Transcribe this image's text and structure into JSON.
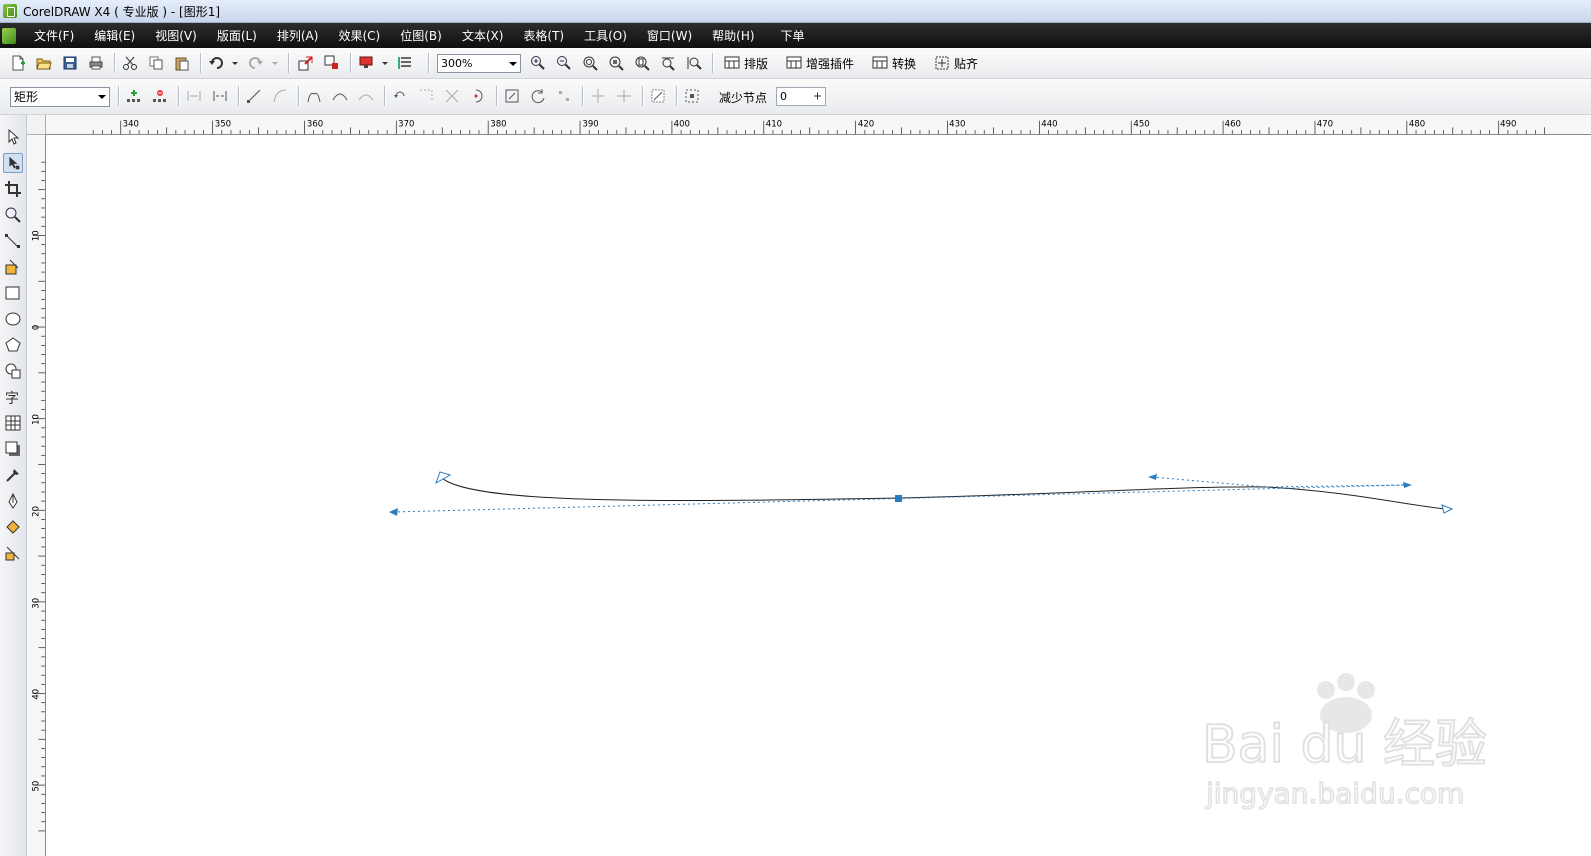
{
  "window": {
    "title": "CorelDRAW X4 ( 专业版 ) - [图形1]"
  },
  "menu": [
    {
      "label": "文件(F)"
    },
    {
      "label": "编辑(E)"
    },
    {
      "label": "视图(V)"
    },
    {
      "label": "版面(L)"
    },
    {
      "label": "排列(A)"
    },
    {
      "label": "效果(C)"
    },
    {
      "label": "位图(B)"
    },
    {
      "label": "文本(X)"
    },
    {
      "label": "表格(T)"
    },
    {
      "label": "工具(O)"
    },
    {
      "label": "窗口(W)"
    },
    {
      "label": "帮助(H)"
    },
    {
      "label": "下单"
    }
  ],
  "toolbar": {
    "zoom_value": "300%",
    "plugins": [
      {
        "label": "排版"
      },
      {
        "label": "增强插件"
      },
      {
        "label": "转换"
      },
      {
        "label": "贴齐"
      }
    ]
  },
  "property_bar": {
    "shape_type": "矩形",
    "reduce_nodes_label": "减少节点",
    "reduce_nodes_value": "0"
  },
  "rulers": {
    "horizontal_ticks": [
      "340",
      "350",
      "360",
      "370",
      "380",
      "390",
      "400",
      "410",
      "420",
      "430",
      "440",
      "450",
      "460",
      "470",
      "480",
      "490"
    ],
    "vertical_ticks": [
      "10",
      "0",
      "10",
      "20",
      "30",
      "40",
      "50"
    ]
  },
  "watermark": {
    "logo_text": "Bai du 经验",
    "url_text": "jingyan.baidu.com"
  }
}
